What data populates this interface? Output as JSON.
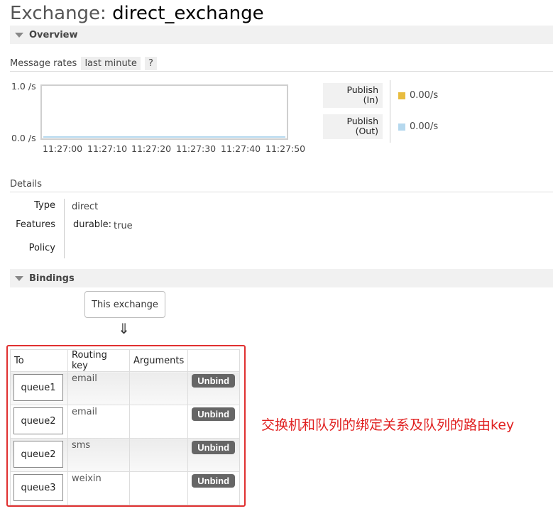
{
  "page": {
    "title_prefix": "Exchange:",
    "title_name": "direct_exchange"
  },
  "overview": {
    "section_label": "Overview",
    "message_rates_label": "Message rates",
    "range_label": "last minute",
    "help_label": "?",
    "chart_data": {
      "type": "line",
      "title": "",
      "ylim": [
        0,
        1
      ],
      "y_tick_labels": [
        "1.0 /s",
        "0.0 /s"
      ],
      "x_tick_labels": [
        "11:27:00",
        "11:27:10",
        "11:27:20",
        "11:27:30",
        "11:27:40",
        "11:27:50"
      ],
      "series": [
        {
          "name": "Publish (In)",
          "color": "#e8bc3f",
          "values": [
            0,
            0,
            0,
            0,
            0,
            0
          ]
        },
        {
          "name": "Publish (Out)",
          "color": "#b5d8ee",
          "values": [
            0,
            0,
            0,
            0,
            0,
            0
          ]
        }
      ]
    },
    "legend": [
      {
        "label_line1": "Publish",
        "label_line2": "(In)",
        "value": "0.00/s",
        "color": "#e8bc3f"
      },
      {
        "label_line1": "Publish",
        "label_line2": "(Out)",
        "value": "0.00/s",
        "color": "#b5d8ee"
      }
    ]
  },
  "details": {
    "heading": "Details",
    "type_key": "Type",
    "type_value": "direct",
    "features_key": "Features",
    "durable_key": "durable:",
    "durable_value": "true",
    "policy_key": "Policy"
  },
  "bindings": {
    "section_label": "Bindings",
    "this_exchange_label": "This exchange",
    "arrow": "⇓",
    "columns": [
      "To",
      "Routing key",
      "Arguments",
      ""
    ],
    "rows": [
      {
        "to": "queue1",
        "routing_key": "email",
        "arguments": "",
        "action": "Unbind"
      },
      {
        "to": "queue2",
        "routing_key": "email",
        "arguments": "",
        "action": "Unbind"
      },
      {
        "to": "queue2",
        "routing_key": "sms",
        "arguments": "",
        "action": "Unbind"
      },
      {
        "to": "queue3",
        "routing_key": "weixin",
        "arguments": "",
        "action": "Unbind"
      }
    ]
  },
  "annotation": {
    "text": "交换机和队列的绑定关系及队列的路由key",
    "color": "#e02020"
  }
}
